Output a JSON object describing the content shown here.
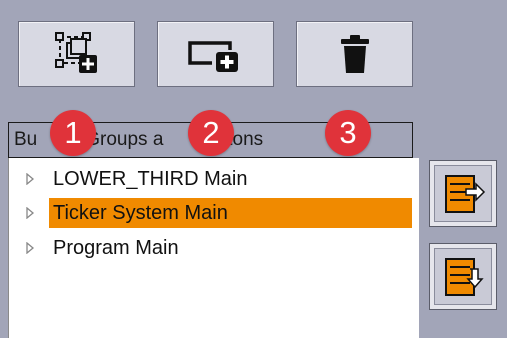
{
  "toolbar": {
    "buttons": [
      {
        "icon": "new-group-icon"
      },
      {
        "icon": "new-button-icon"
      },
      {
        "icon": "trash-icon"
      }
    ]
  },
  "panel": {
    "header": "Bu",
    "header_tail_1": "Groups a",
    "header_tail_2": "uttons"
  },
  "tree": {
    "items": [
      {
        "label": "LOWER_THIRD Main",
        "selected": false
      },
      {
        "label": "Ticker System Main",
        "selected": true
      },
      {
        "label": "Program Main",
        "selected": false
      }
    ]
  },
  "badges": [
    "1",
    "2",
    "3"
  ],
  "side_buttons": [
    {
      "icon": "export-list-icon"
    },
    {
      "icon": "import-list-icon"
    }
  ],
  "colors": {
    "selection": "#f08a00",
    "badge": "#e0333a",
    "background": "#a2a5b8"
  }
}
